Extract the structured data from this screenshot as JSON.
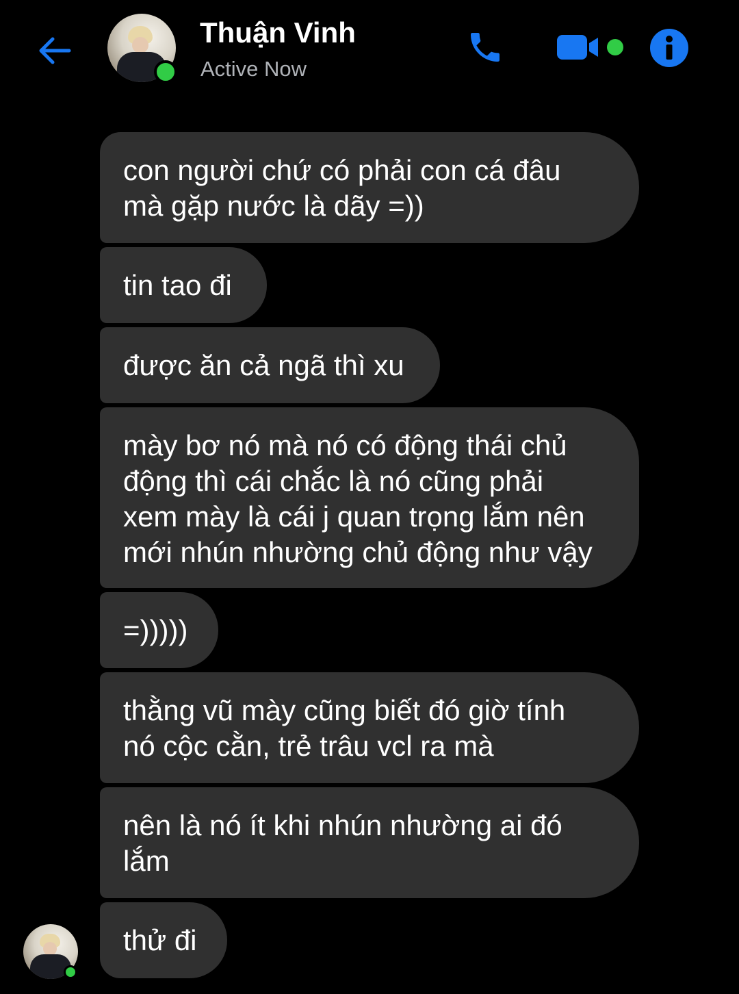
{
  "header": {
    "name": "Thuận Vinh",
    "status": "Active Now",
    "icons": {
      "back": "back-arrow-icon",
      "call": "phone-icon",
      "video": "video-camera-icon",
      "info": "info-icon"
    },
    "accent_color": "#1877f2",
    "online_color": "#31cc46"
  },
  "messages": [
    {
      "text": "con người chứ có phải con cá đâu\nmà gặp nước là dãy =))"
    },
    {
      "text": "tin tao đi"
    },
    {
      "text": "được ăn cả ngã thì xu"
    },
    {
      "text": "mày bơ nó mà nó có động thái chủ\nđộng thì cái chắc là nó cũng phải\nxem mày là cái j quan trọng lắm nên\nmới nhún nhường chủ động như vậy"
    },
    {
      "text": "=)))))"
    },
    {
      "text": "thằng vũ mày cũng biết đó giờ tính\nnó cộc cằn, trẻ trâu vcl ra mà"
    },
    {
      "text": "nên là nó ít khi nhún nhường ai đó\nlắm"
    },
    {
      "text": "thử đi"
    }
  ],
  "bubble_color": "#303030"
}
